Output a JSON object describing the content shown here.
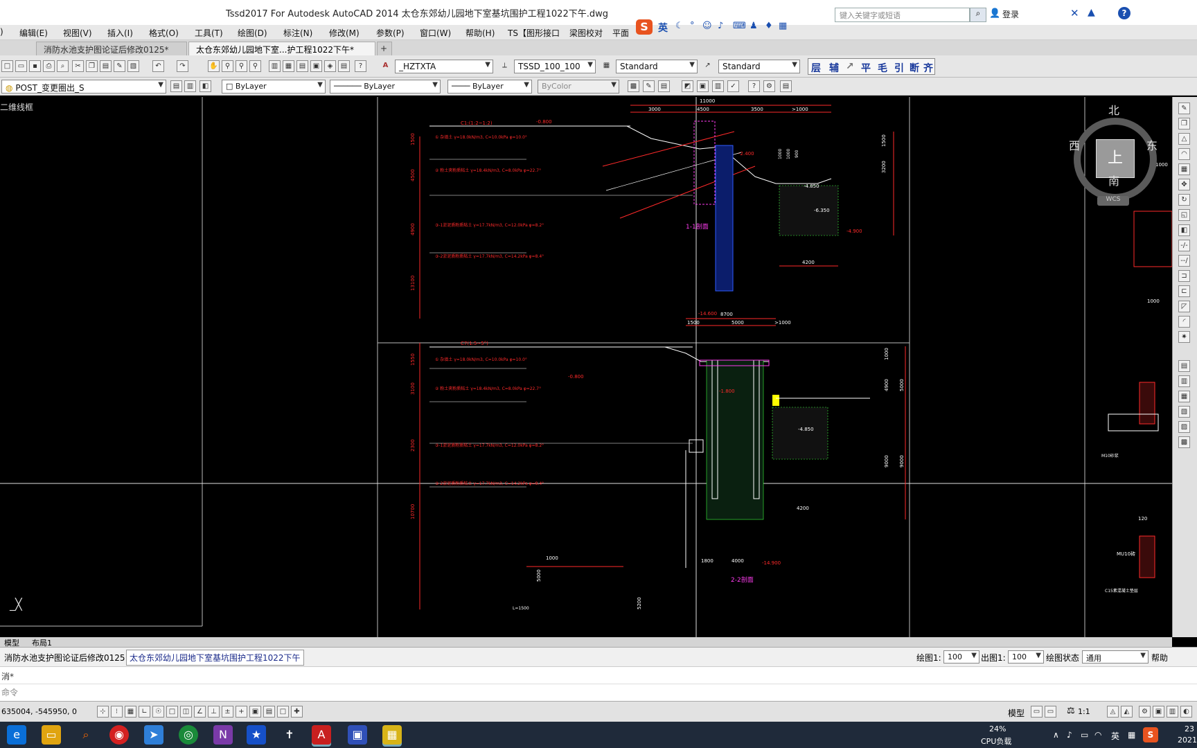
{
  "window": {
    "title": "Tssd2017 For Autodesk AutoCAD 2014      太仓东郊幼儿园地下室基坑围护工程1022下午.dwg",
    "search_placeholder": "键入关键字或短语",
    "login": "登录"
  },
  "menu": [
    "编辑(E)",
    "视图(V)",
    "插入(I)",
    "格式(O)",
    "工具(T)",
    "绘图(D)",
    "标注(N)",
    "修改(M)",
    "参数(P)",
    "窗口(W)",
    "帮助(H)",
    "TS【图形接口",
    "梁图校对",
    "平面"
  ],
  "ime": {
    "lang": "英"
  },
  "doc_tabs": [
    {
      "label": "消防水池支护图论证后修改0125*",
      "active": false
    },
    {
      "label": "太仓东郊幼儿园地下室...护工程1022下午*",
      "active": true
    }
  ],
  "toolbar1": {
    "text_style": "_HZTXTA",
    "dim_style": "TSSD_100_100",
    "table_style": "Standard",
    "multileader_style": "Standard",
    "tssd_buttons": [
      "层",
      "辅",
      "平",
      "毛",
      "引",
      "断",
      "齐"
    ]
  },
  "toolbar2": {
    "layer": "POST_变更圈出_S",
    "color": "ByLayer",
    "linetype": "ByLayer",
    "lineweight": "ByLayer",
    "plotstyle": "ByColor"
  },
  "viewport": {
    "label": "二维线框"
  },
  "viewcube": {
    "north": "北",
    "south": "南",
    "east": "东",
    "west": "西",
    "top": "上",
    "wcs": "WCS"
  },
  "drawing": {
    "sec1": {
      "dims_top": [
        "11000",
        "3000",
        "4500",
        "3500",
        ">1000"
      ],
      "levels": [
        "-0.800",
        "-2.400",
        "-4.850",
        "-6.350",
        "-4.900",
        "-14.600"
      ],
      "dim_left": [
        "1500",
        "4500",
        "4900",
        "13100"
      ],
      "dim_right": [
        "1500",
        "3200",
        "1000",
        "1000",
        "900"
      ],
      "bottom_dim": "4200",
      "title": "1-1剖面",
      "soil_rows": [
        "① 杂填土 γ=18.0kN/m3, C=10.0kPa φ=10.0°",
        "② 粉土夹粉质粘土 γ=18.4kN/m3, C=8.0kPa φ=22.7°",
        "③-1淤泥质粉质粘土 γ=17.7kN/m3, C=12.0kPa φ=8.2°",
        "③-2淤泥质粉质粘土 γ=17.7kN/m3, C=14.2kPa φ=8.4°"
      ],
      "slope": "C1:(1:2~1:2)"
    },
    "sec2": {
      "dims_top": [
        "8700",
        "1500",
        "5000",
        ">1000"
      ],
      "levels": [
        "-0.800",
        "-1.800",
        "-4.850",
        "-14.900"
      ],
      "dim_left": [
        "1550",
        "3100",
        "2300",
        "10700"
      ],
      "dim_right": [
        "1000",
        "4900",
        "5000",
        "9000",
        "9000"
      ],
      "bottom_dims": [
        "4200",
        "1800",
        "4000"
      ],
      "title": "2-2剖面",
      "soil_rows": [
        "① 杂填土 γ=18.0kN/m3, C=10.0kPa φ=10.0°",
        "② 粉土夹粉质粘土 γ=18.4kN/m3, C=8.0kPa φ=22.7°",
        "③-1淤泥质粉质粘土 γ=17.7kN/m3, C=12.0kPa φ=8.2°",
        "③-2淤泥质粉质粘土 γ=17.7kN/m3, C=14.2kPa φ=8.4°"
      ],
      "slope": "C7(1:5~5°)"
    },
    "sec3": {
      "dims": [
        "1000",
        "5000",
        "5200"
      ],
      "label": "L=1500"
    },
    "right_labels": [
      "1000",
      "1000",
      "120",
      "MU10砖",
      "M10砂浆",
      "C15素混凝土垫层"
    ]
  },
  "layout_tabs": [
    "模型",
    "布局1"
  ],
  "files": [
    {
      "label": "消防水池支护图论证后修改0125",
      "active": false
    },
    {
      "label": "太仓东郊幼儿园地下室基坑围护工程1022下午",
      "active": true
    }
  ],
  "scale": {
    "draw_label": "绘图1:",
    "draw_value": "100",
    "out_label": "出图1:",
    "out_value": "100",
    "state_label": "绘图状态",
    "state_value": "通用",
    "help": "帮助"
  },
  "command": {
    "history": "消*",
    "prompt": "命令"
  },
  "status": {
    "coords": "635004, -545950, 0",
    "model": "模型",
    "anno_scale": "1:1"
  },
  "taskbar": {
    "cpu_percent": "24%",
    "cpu_label": "CPU负载",
    "lang": "英",
    "time": "23",
    "date": "2021"
  },
  "colors": {
    "canvas": "#000000",
    "red": "#ff2a2a",
    "cyan": "#00e5ff",
    "magenta": "#ff3cf0",
    "yellow": "#ffff00",
    "green": "#3cff3c",
    "blue": "#2f5dff"
  }
}
